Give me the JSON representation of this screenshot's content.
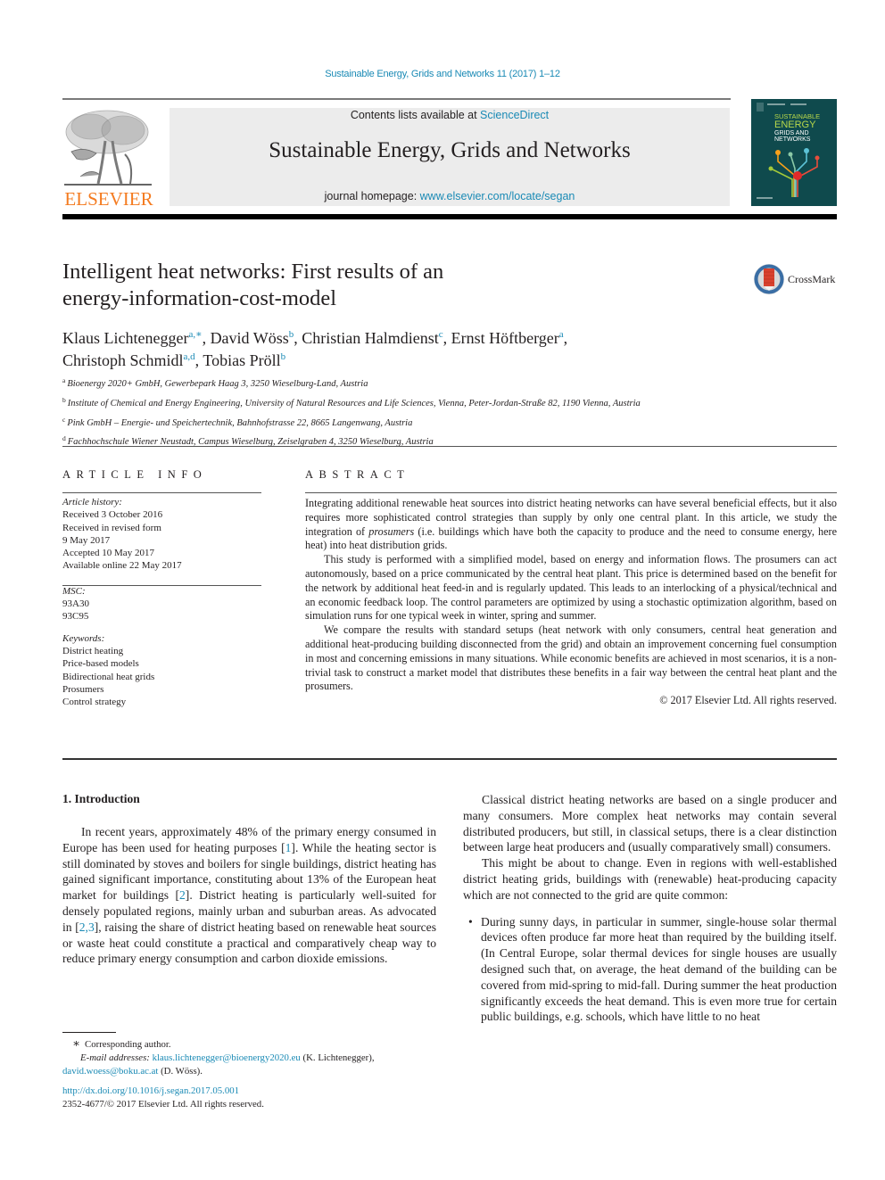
{
  "running_head": "Sustainable Energy, Grids and Networks 11 (2017) 1–12",
  "header": {
    "publisher": "ELSEVIER",
    "contents_prefix": "Contents lists available at ",
    "contents_link": "ScienceDirect",
    "journal_title": "Sustainable Energy, Grids and Networks",
    "homepage_prefix": "journal homepage: ",
    "homepage_link": "www.elsevier.com/locate/segan",
    "cover": {
      "line1": "SUSTAINABLE",
      "line2": "ENERGY",
      "line3": "GRIDS AND",
      "line4": "NETWORKS"
    },
    "colors": {
      "publisher_orange": "#f47b20",
      "link_blue": "#1a8ab5",
      "band_gray": "#ececec",
      "cover_teal": "#0f4a4d"
    }
  },
  "article": {
    "title_line1": "Intelligent heat networks: First results of an",
    "title_line2": "energy-information-cost-model",
    "crossmark_label": "CrossMark",
    "authors": [
      {
        "name": "Klaus Lichtenegger",
        "sup": "a,∗",
        "sep": ", "
      },
      {
        "name": "David Wöss",
        "sup": "b",
        "sep": ", "
      },
      {
        "name": "Christian Halmdienst",
        "sup": "c",
        "sep": ", "
      },
      {
        "name": "Ernst Höftberger",
        "sup": "a",
        "sep": ","
      },
      {
        "name": "Christoph Schmidl",
        "sup": "a,d",
        "sep": ", "
      },
      {
        "name": "Tobias Pröll",
        "sup": "b",
        "sep": ""
      }
    ],
    "affiliations": [
      {
        "key": "a",
        "text": "Bioenergy 2020+ GmbH, Gewerbepark Haag 3, 3250 Wieselburg-Land, Austria"
      },
      {
        "key": "b",
        "text": "Institute of Chemical and Energy Engineering, University of Natural Resources and Life Sciences, Vienna, Peter-Jordan-Straße 82, 1190 Vienna, Austria"
      },
      {
        "key": "c",
        "text": "Pink GmbH – Energie- und Speichertechnik, Bahnhofstrasse 22, 8665 Langenwang, Austria"
      },
      {
        "key": "d",
        "text": "Fachhochschule Wiener Neustadt, Campus Wieselburg, Zeiselgraben 4, 3250 Wieselburg, Austria"
      }
    ]
  },
  "article_info": {
    "heading": "ARTICLE INFO",
    "history_label": "Article history:",
    "history": [
      "Received 3 October 2016",
      "Received in revised form",
      "9 May 2017",
      "Accepted 10 May 2017",
      "Available online 22 May 2017"
    ],
    "msc_label": "MSC:",
    "msc": [
      "93A30",
      "93C95"
    ],
    "keywords_label": "Keywords:",
    "keywords": [
      "District heating",
      "Price-based models",
      "Bidirectional heat grids",
      "Prosumers",
      "Control strategy"
    ]
  },
  "abstract": {
    "heading": "ABSTRACT",
    "p1_a": "Integrating additional renewable heat sources into district heating networks can have several beneficial effects, but it also requires more sophisticated control strategies than supply by only one central plant. In this article, we study the integration of ",
    "p1_em": "prosumers",
    "p1_b": " (i.e. buildings which have both the capacity to produce and the need to consume energy, here heat) into heat distribution grids.",
    "p2": "This study is performed with a simplified model, based on energy and information flows. The prosumers can act autonomously, based on a price communicated by the central heat plant. This price is determined based on the benefit for the network by additional heat feed-in and is regularly updated. This leads to an interlocking of a physical/technical and an economic feedback loop. The control parameters are optimized by using a stochastic optimization algorithm, based on simulation runs for one typical week in winter, spring and summer.",
    "p3": "We compare the results with standard setups (heat network with only consumers, central heat generation and additional heat-producing building disconnected from the grid) and obtain an improvement concerning fuel consumption in most and concerning emissions in many situations. While economic benefits are achieved in most scenarios, it is a non-trivial task to construct a market model that distributes these benefits in a fair way between the central heat plant and the prosumers.",
    "copyright": "© 2017 Elsevier Ltd. All rights reserved."
  },
  "body": {
    "section_heading": "1.  Introduction",
    "left_p1_a": "In recent years, approximately 48% of the primary energy consumed in Europe has been used for heating purposes [",
    "ref1": "1",
    "left_p1_b": "]. While the heating sector is still dominated by stoves and boilers for single buildings, district heating has gained significant importance, constituting about 13% of the European heat market for buildings [",
    "ref2": "2",
    "left_p1_c": "]. District heating is particularly well-suited for densely populated regions, mainly urban and suburban areas. As advocated in [",
    "ref23": "2,3",
    "left_p1_d": "], raising the share of district heating based on renewable heat sources or waste heat could constitute a practical and comparatively cheap way to reduce primary energy consumption and carbon dioxide emissions.",
    "right_p1": "Classical district heating networks are based on a single producer and many consumers. More complex heat networks may contain several distributed producers, but still, in classical setups, there is a clear distinction between large heat producers and (usually comparatively small) consumers.",
    "right_p2": "This might be about to change. Even in regions with well-established district heating grids, buildings with (renewable) heat-producing capacity which are not connected to the grid are quite common:",
    "bullet1": "During sunny days, in particular in summer, single-house solar thermal devices often produce far more heat than required by the building itself. (In Central Europe, solar thermal devices for single houses are usually designed such that, on average, the heat demand of the building can be covered from mid-spring to mid-fall. During summer the heat production significantly exceeds the heat demand. This is even more true for certain public buildings, e.g. schools, which have little to no heat"
  },
  "footnotes": {
    "star": "∗",
    "corresponding": "Corresponding author.",
    "email_label": "E-mail addresses:",
    "email1": "klaus.lichtenegger@bioenergy2020.eu",
    "email1_name": " (K. Lichtenegger),",
    "email2": "david.woess@boku.ac.at",
    "email2_name": " (D. Wöss).",
    "doi": "http://dx.doi.org/10.1016/j.segan.2017.05.001",
    "issn_line": "2352-4677/© 2017 Elsevier Ltd. All rights reserved."
  }
}
